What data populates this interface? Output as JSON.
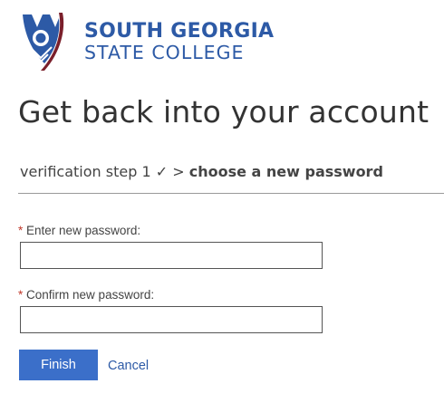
{
  "logo": {
    "line1": "SOUTH GEORGIA",
    "line2": "STATE COLLEGE",
    "colors": {
      "blue": "#2d5aa6",
      "maroon": "#7a1f2b"
    }
  },
  "page": {
    "title": "Get back into your account"
  },
  "steps": {
    "previous": "verification step 1",
    "check": "✓",
    "separator": ">",
    "current": "choose a new password"
  },
  "form": {
    "required_marker": "*",
    "new_password": {
      "label": "Enter new password:",
      "value": ""
    },
    "confirm_password": {
      "label": "Confirm new password:",
      "value": ""
    }
  },
  "actions": {
    "finish_label": "Finish",
    "cancel_label": "Cancel"
  },
  "colors": {
    "accent": "#3b6fc9",
    "link": "#2d5aa6",
    "required": "#c0392b"
  }
}
